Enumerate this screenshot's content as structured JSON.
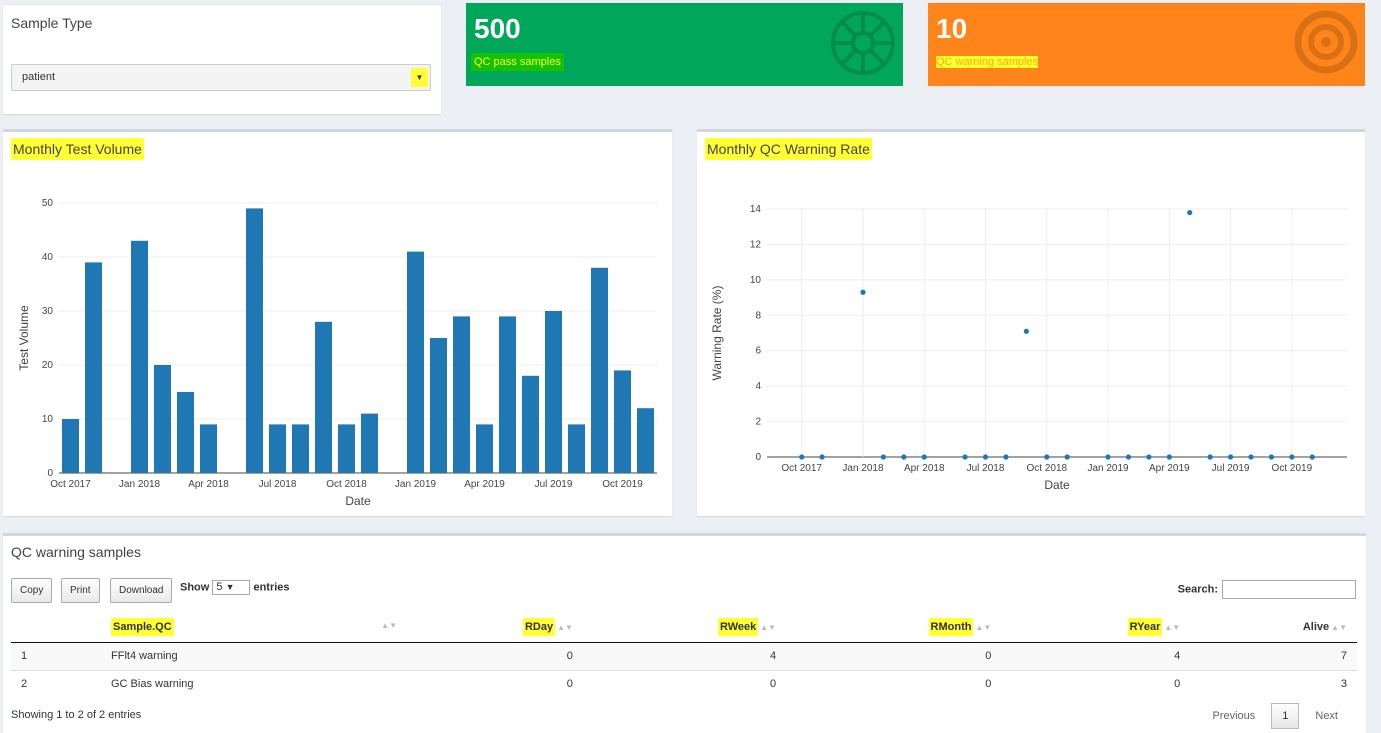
{
  "sample_type": {
    "label": "Sample Type",
    "selected": "patient"
  },
  "value_boxes": [
    {
      "value": "500",
      "label": "QC pass samples",
      "color": "#00a65a",
      "icon": "galactic-empire-icon"
    },
    {
      "value": "10",
      "label": "QC warning samples",
      "color": "#ff851b",
      "icon": "bullseye-icon"
    }
  ],
  "volume_box": {
    "title": "Monthly Test Volume"
  },
  "rate_box": {
    "title": "Monthly QC Warning Rate"
  },
  "chart_data": [
    {
      "type": "bar",
      "title": "",
      "xlabel": "Date",
      "ylabel": "Test Volume",
      "ylim": [
        0,
        50
      ],
      "yticks": [
        0,
        10,
        20,
        30,
        40,
        50
      ],
      "xticks": [
        "Oct 2017",
        "Jan 2018",
        "Apr 2018",
        "Jul 2018",
        "Oct 2018",
        "Jan 2019",
        "Apr 2019",
        "Jul 2019",
        "Oct 2019"
      ],
      "x": [
        "2017-10",
        "2017-11",
        "2017-12",
        "2018-01",
        "2018-02",
        "2018-03",
        "2018-04",
        "2018-05",
        "2018-06",
        "2018-07",
        "2018-08",
        "2018-09",
        "2018-10",
        "2018-11",
        "2018-12",
        "2019-01",
        "2019-02",
        "2019-03",
        "2019-04",
        "2019-05",
        "2019-06",
        "2019-07",
        "2019-08",
        "2019-09",
        "2019-10",
        "2019-11"
      ],
      "values": [
        10,
        39,
        null,
        43,
        20,
        15,
        9,
        null,
        49,
        9,
        9,
        28,
        9,
        11,
        null,
        41,
        25,
        29,
        9,
        29,
        18,
        30,
        9,
        38,
        19,
        12
      ],
      "color": "#1f77b4"
    },
    {
      "type": "scatter",
      "title": "",
      "xlabel": "Date",
      "ylabel": "Warning Rate (%)",
      "ylim": [
        0,
        14
      ],
      "yticks": [
        0,
        2,
        4,
        6,
        8,
        10,
        12,
        14
      ],
      "xticks": [
        "Oct 2017",
        "Jan 2018",
        "Apr 2018",
        "Jul 2018",
        "Oct 2018",
        "Jan 2019",
        "Apr 2019",
        "Jul 2019",
        "Oct 2019"
      ],
      "x": [
        "2017-10",
        "2017-11",
        "2018-01",
        "2018-02",
        "2018-03",
        "2018-04",
        "2018-06",
        "2018-07",
        "2018-08",
        "2018-09",
        "2018-10",
        "2018-11",
        "2019-01",
        "2019-02",
        "2019-03",
        "2019-04",
        "2019-05",
        "2019-06",
        "2019-07",
        "2019-08",
        "2019-09",
        "2019-10",
        "2019-11"
      ],
      "values": [
        0,
        0,
        9.3,
        0,
        0,
        0,
        0,
        0,
        0,
        7.1,
        0,
        0,
        0,
        0,
        0,
        0,
        13.8,
        0,
        0,
        0,
        0,
        0,
        0
      ],
      "color": "#1f77b4"
    }
  ],
  "table_box": {
    "title": "QC warning samples",
    "buttons": [
      "Copy",
      "Print",
      "Download"
    ],
    "show_label": "Show",
    "show_value": "5",
    "entries_label": "entries",
    "search_label": "Search:",
    "columns": [
      "",
      "Sample.QC",
      "RDay",
      "RWeek",
      "RMonth",
      "RYear",
      "Alive"
    ],
    "rows": [
      [
        "1",
        "FFlt4 warning",
        "0",
        "4",
        "0",
        "4",
        "7"
      ],
      [
        "2",
        "GC Bias warning",
        "0",
        "0",
        "0",
        "0",
        "3"
      ]
    ],
    "info": "Showing 1 to 2 of 2 entries",
    "pager": {
      "previous": "Previous",
      "current": "1",
      "next": "Next"
    }
  }
}
